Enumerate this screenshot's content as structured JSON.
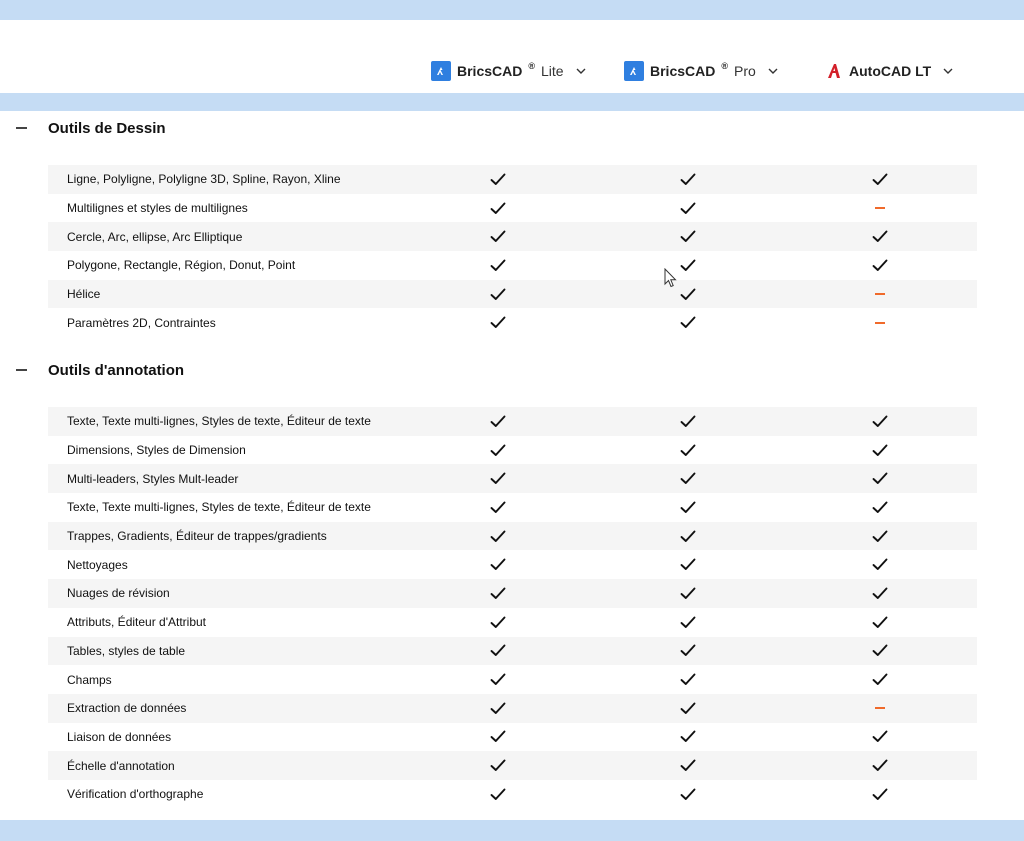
{
  "columns": [
    {
      "brand": "BricsCAD",
      "reg": "®",
      "edition": "Lite",
      "icon": "bricscad-logo-icon",
      "color": "#2f7fe0"
    },
    {
      "brand": "BricsCAD",
      "reg": "®",
      "edition": "Pro",
      "icon": "bricscad-logo-icon",
      "color": "#2f7fe0"
    },
    {
      "brand": "AutoCAD LT",
      "reg": "",
      "edition": "",
      "icon": "autocad-logo-icon",
      "color": "#d3202a"
    }
  ],
  "colors": {
    "band": "#c5dcf4",
    "check": "#111111",
    "dash": "#f06a2b",
    "row_alt": "#f5f5f5"
  },
  "sections": [
    {
      "title": "Outils de Dessin",
      "toggle": "collapse-minus-icon",
      "rows": [
        {
          "feature": "Ligne, Polyligne, Polyligne 3D, Spline, Rayon, Xline",
          "values": [
            "check",
            "check",
            "check"
          ]
        },
        {
          "feature": "Multilignes et styles de multilignes",
          "values": [
            "check",
            "check",
            "dash"
          ]
        },
        {
          "feature": "Cercle, Arc, ellipse, Arc Elliptique",
          "values": [
            "check",
            "check",
            "check"
          ]
        },
        {
          "feature": "Polygone, Rectangle, Région, Donut, Point",
          "values": [
            "check",
            "check",
            "check"
          ]
        },
        {
          "feature": "Hélice",
          "values": [
            "check",
            "check",
            "dash"
          ]
        },
        {
          "feature": "Paramètres 2D, Contraintes",
          "values": [
            "check",
            "check",
            "dash"
          ]
        }
      ]
    },
    {
      "title": "Outils d'annotation",
      "toggle": "collapse-minus-icon",
      "rows": [
        {
          "feature": "Texte, Texte multi-lignes, Styles de texte, Éditeur de texte",
          "values": [
            "check",
            "check",
            "check"
          ]
        },
        {
          "feature": "Dimensions, Styles de Dimension",
          "values": [
            "check",
            "check",
            "check"
          ]
        },
        {
          "feature": "Multi-leaders, Styles Mult-leader",
          "values": [
            "check",
            "check",
            "check"
          ]
        },
        {
          "feature": "Texte, Texte multi-lignes, Styles de texte, Éditeur de texte",
          "values": [
            "check",
            "check",
            "check"
          ]
        },
        {
          "feature": "Trappes, Gradients, Éditeur de trappes/gradients",
          "values": [
            "check",
            "check",
            "check"
          ]
        },
        {
          "feature": "Nettoyages",
          "values": [
            "check",
            "check",
            "check"
          ]
        },
        {
          "feature": "Nuages de révision",
          "values": [
            "check",
            "check",
            "check"
          ]
        },
        {
          "feature": "Attributs, Éditeur d'Attribut",
          "values": [
            "check",
            "check",
            "check"
          ]
        },
        {
          "feature": "Tables, styles de table",
          "values": [
            "check",
            "check",
            "check"
          ]
        },
        {
          "feature": "Champs",
          "values": [
            "check",
            "check",
            "check"
          ]
        },
        {
          "feature": "Extraction de données",
          "values": [
            "check",
            "check",
            "dash"
          ]
        },
        {
          "feature": "Liaison de données",
          "values": [
            "check",
            "check",
            "check"
          ]
        },
        {
          "feature": "Échelle d'annotation",
          "values": [
            "check",
            "check",
            "check"
          ]
        },
        {
          "feature": "Vérification d'orthographe",
          "values": [
            "check",
            "check",
            "check"
          ]
        }
      ]
    }
  ]
}
